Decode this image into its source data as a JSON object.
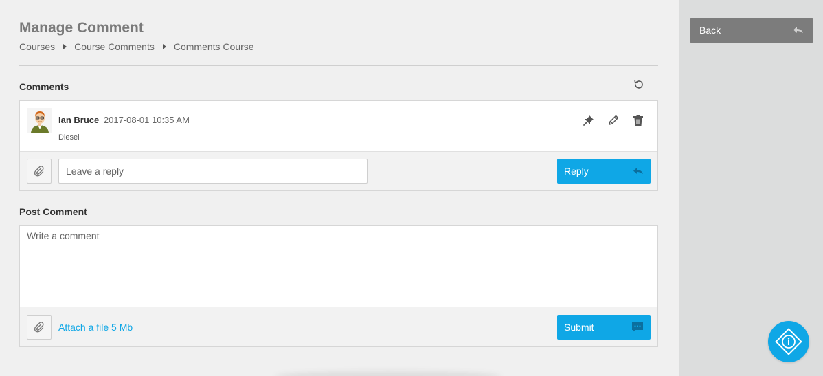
{
  "header": {
    "title": "Manage Comment",
    "breadcrumb": [
      "Courses",
      "Course Comments",
      "Comments Course"
    ]
  },
  "comments_section": {
    "label": "Comments",
    "refresh_icon": "refresh-icon",
    "items": [
      {
        "author": "Ian Bruce",
        "date": "2017-08-01 10:35 AM",
        "text": "Diesel",
        "actions": [
          "pin-icon",
          "pencil-icon",
          "trash-icon"
        ]
      }
    ],
    "reply": {
      "placeholder": "Leave a reply",
      "button_label": "Reply",
      "button_icon": "reply-icon"
    }
  },
  "post_section": {
    "label": "Post Comment",
    "placeholder": "Write a comment",
    "attach_label": "Attach a file 5 Mb",
    "submit_label": "Submit",
    "submit_icon": "chat-icon"
  },
  "sidebar": {
    "back_label": "Back",
    "back_icon": "reply-icon"
  },
  "colors": {
    "accent": "#0fa7e6",
    "back_button": "#7c7c7c",
    "sidebar_bg": "#dcdddd"
  }
}
